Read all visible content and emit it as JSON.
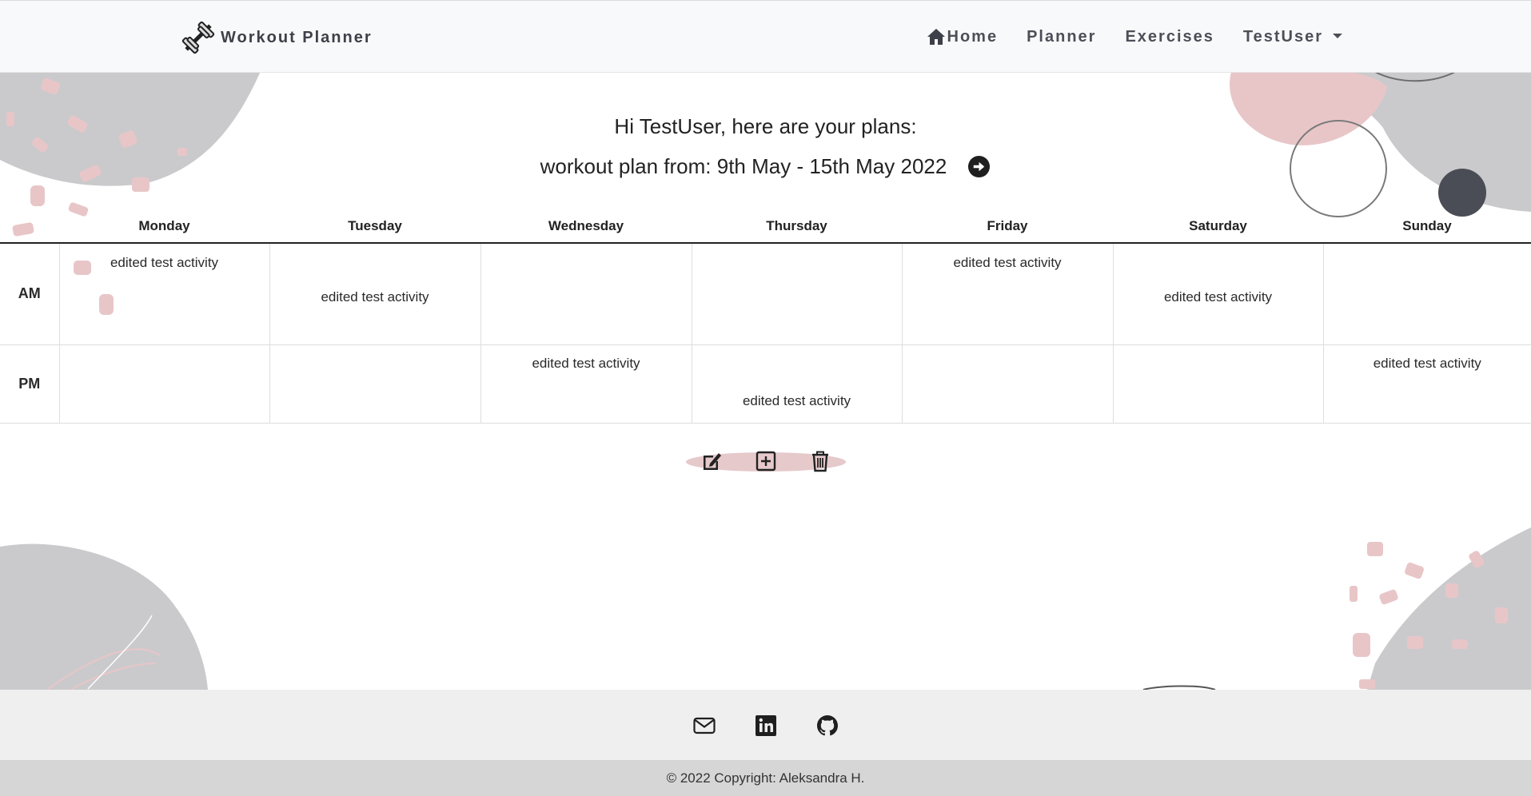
{
  "nav": {
    "brand": "Workout Planner",
    "links": [
      "Home",
      "Planner",
      "Exercises"
    ],
    "user": "TestUser"
  },
  "main": {
    "greeting": "Hi TestUser, here are your plans:",
    "plan_range": "workout plan from: 9th May - 15th May 2022"
  },
  "planner": {
    "days": [
      "Monday",
      "Tuesday",
      "Wednesday",
      "Thursday",
      "Friday",
      "Saturday",
      "Sunday"
    ],
    "rows": [
      {
        "label": "AM",
        "cells": [
          "edited test activity",
          "edited test activity",
          "",
          "",
          "edited test activity",
          "edited test activity",
          ""
        ]
      },
      {
        "label": "PM",
        "cells": [
          "",
          "",
          "edited test activity",
          "edited test activity",
          "",
          "",
          "edited test activity"
        ]
      }
    ]
  },
  "actions": [
    "edit-icon",
    "add-icon",
    "delete-icon"
  ],
  "footer": {
    "icons": [
      "email-icon",
      "linkedin-icon",
      "github-icon"
    ],
    "copyright": "© 2022 Copyright: Aleksandra H."
  },
  "colors": {
    "accent_pink": "#e5c9cb",
    "deco_gray": "#c9c9cc",
    "dark_circle": "#4a4d55"
  }
}
